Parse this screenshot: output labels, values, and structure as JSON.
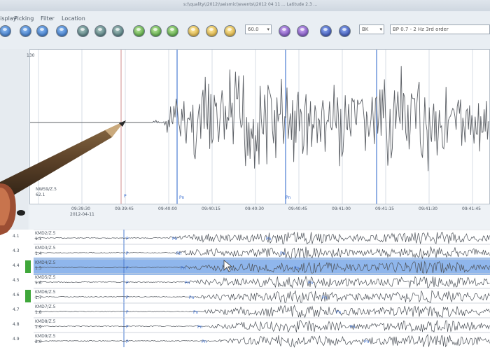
{
  "window": {
    "title": "s:\\\\quality\\\\2012\\\\seismic\\\\events\\\\2012 04 11 ... Latitude 2.3 ..."
  },
  "menu": [
    "Display",
    "Picking",
    "Filter",
    "Location"
  ],
  "toolbar": {
    "buttons": [
      {
        "name": "toolbar-button-1",
        "color": "blue"
      },
      {
        "name": "toolbar-button-2",
        "color": "blue"
      },
      {
        "name": "toolbar-button-3",
        "color": "blue"
      },
      {
        "name": "toolbar-button-4",
        "color": "blue"
      },
      {
        "name": "toolbar-button-5",
        "color": "dk"
      },
      {
        "name": "toolbar-button-6",
        "color": "dk"
      },
      {
        "name": "toolbar-button-7",
        "color": "dk"
      },
      {
        "name": "toolbar-button-8",
        "color": "grn"
      },
      {
        "name": "toolbar-button-9",
        "color": "grn"
      },
      {
        "name": "toolbar-button-10",
        "color": "grn"
      },
      {
        "name": "toolbar-button-11",
        "color": "ylw"
      },
      {
        "name": "toolbar-button-12",
        "color": "ylw"
      },
      {
        "name": "toolbar-button-13",
        "color": "ylw"
      },
      {
        "name": "toolbar-button-14",
        "color": "vio"
      },
      {
        "name": "toolbar-button-15",
        "color": "vio"
      },
      {
        "name": "toolbar-button-16",
        "color": "nav"
      },
      {
        "name": "toolbar-button-17",
        "color": "nav"
      }
    ],
    "time_window": "60.0",
    "component": "BK",
    "filter": "BP 0.7 - 2 Hz 3rd order"
  },
  "main_trace": {
    "station": "NWS9/Z.5",
    "station_sub": "62.1",
    "marker_left": "P",
    "marker_mid": "Pn",
    "marker_right": "Pn",
    "time_ticks": [
      "09:39:30",
      "09:39:45",
      "09:40:00",
      "09:40:15",
      "09:40:30",
      "09:40:45",
      "09:41:00",
      "09:41:15",
      "09:41:30",
      "09:41:45"
    ],
    "date": "2012-04-11",
    "y_top": "130"
  },
  "lower_traces": {
    "rows": [
      {
        "station": "KMD2/Z.5",
        "sub": "1.1",
        "phase_a": "P",
        "phase_b": "Pn",
        "phase_c": "Pn"
      },
      {
        "station": "KMD3/Z.5",
        "sub": "1.4",
        "phase_a": "P",
        "phase_b": "Pn",
        "phase_c": "Pn"
      },
      {
        "station": "KMD4/Z.5",
        "sub": "1.5",
        "phase_a": "P",
        "phase_b": "Pn",
        "phase_c": "Pn"
      },
      {
        "station": "KMD5/Z.5",
        "sub": "1.6",
        "phase_a": "P",
        "phase_b": "Pn",
        "phase_c": "Pn"
      },
      {
        "station": "KMD6/Z.5",
        "sub": "1.7",
        "phase_a": "P",
        "phase_b": "Pn",
        "phase_c": "Pn"
      },
      {
        "station": "KMD7/Z.5",
        "sub": "1.8",
        "phase_a": "P",
        "phase_b": "Pn",
        "phase_c": "Pn"
      },
      {
        "station": "KMD8/Z.5",
        "sub": "1.9",
        "phase_a": "P",
        "phase_b": "Pn",
        "phase_c": "Pn"
      },
      {
        "station": "KMD9/Z.5",
        "sub": "2.0",
        "phase_a": "P",
        "phase_b": "Pn",
        "phase_c": "Pn"
      }
    ],
    "side_labels": [
      "4.1",
      "4.3",
      "4.4",
      "4.5",
      "4.6",
      "4.7",
      "4.8",
      "4.9"
    ]
  }
}
